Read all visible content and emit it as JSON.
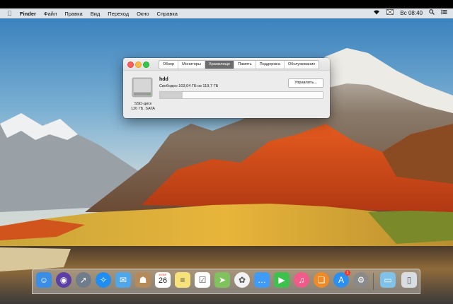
{
  "menubar": {
    "app": "Finder",
    "items": [
      "Файл",
      "Правка",
      "Вид",
      "Переход",
      "Окно",
      "Справка"
    ],
    "clock": "Вс 08:40"
  },
  "window": {
    "tabs": [
      "Обзор",
      "Мониторы",
      "Хранилище",
      "Память",
      "Поддержка",
      "Обслуживание"
    ],
    "active_tab": "Хранилище",
    "disk_name": "hdd",
    "disk_free": "Свободно 103,04 ГБ из 119,7 ГБ",
    "manage_label": "Управлять...",
    "disk_type": "SSD-диск",
    "disk_spec": "120 ГБ, SATA",
    "used_fraction": 0.139
  },
  "dock": {
    "items": [
      {
        "name": "finder",
        "icon": "finder-icon",
        "color": "#3a8ee6"
      },
      {
        "name": "siri",
        "icon": "siri-icon",
        "color": "#5b3fa6"
      },
      {
        "name": "launchpad",
        "icon": "rocket-icon",
        "color": "#6f7c8c"
      },
      {
        "name": "safari",
        "icon": "compass-icon",
        "color": "#1f8ef0"
      },
      {
        "name": "mail",
        "icon": "mail-icon",
        "color": "#4fa6e8"
      },
      {
        "name": "contacts",
        "icon": "contacts-icon",
        "color": "#b58a5a"
      },
      {
        "name": "calendar",
        "icon": "calendar-icon",
        "color": "#ffffff",
        "month": "ФЕВР.",
        "day": "26"
      },
      {
        "name": "notes",
        "icon": "notes-icon",
        "color": "#f7e27a"
      },
      {
        "name": "reminders",
        "icon": "reminders-icon",
        "color": "#ffffff"
      },
      {
        "name": "maps",
        "icon": "maps-icon",
        "color": "#7fc25e"
      },
      {
        "name": "photos",
        "icon": "photos-icon",
        "color": "#f2f2f2"
      },
      {
        "name": "messages",
        "icon": "messages-icon",
        "color": "#3f9bf5"
      },
      {
        "name": "facetime",
        "icon": "facetime-icon",
        "color": "#3cc24c"
      },
      {
        "name": "itunes",
        "icon": "music-icon",
        "color": "#f25a8a"
      },
      {
        "name": "ibooks",
        "icon": "book-icon",
        "color": "#f08a26"
      },
      {
        "name": "app-store",
        "icon": "app-store-icon",
        "color": "#2b8ff0",
        "badge": "1"
      },
      {
        "name": "system-preferences",
        "icon": "gear-icon",
        "color": "#8a8a8a"
      },
      {
        "name": "downloads-folder",
        "icon": "folder-icon",
        "color": "#7ec2ea"
      },
      {
        "name": "trash",
        "icon": "trash-icon",
        "color": "#d8dde2"
      }
    ]
  }
}
